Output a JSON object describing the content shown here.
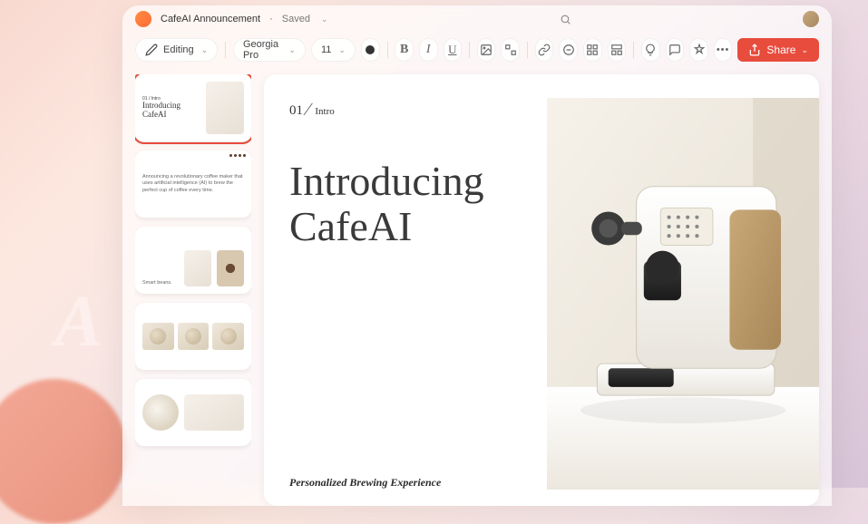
{
  "document": {
    "name": "CafeAI Announcement",
    "status": "Saved"
  },
  "toolbar": {
    "mode": "Editing",
    "font_family": "Georgia Pro",
    "font_size": "11",
    "share_label": "Share"
  },
  "thumbnails": [
    {
      "title": "Introducing CafeAI"
    },
    {
      "body": "Announcing a revolutionary coffee maker that uses artificial intelligence (AI) to brew the perfect cup of coffee every time."
    },
    {
      "caption": "Smart beans."
    },
    {
      "caption": ""
    },
    {
      "caption": ""
    }
  ],
  "slide": {
    "number": "01",
    "section": "Intro",
    "title_line1": "Introducing",
    "title_line2": "CafeAI",
    "footer": "Personalized Brewing Experience"
  },
  "colors": {
    "accent": "#e84c3d",
    "brand_orange": "#ff6b35"
  }
}
